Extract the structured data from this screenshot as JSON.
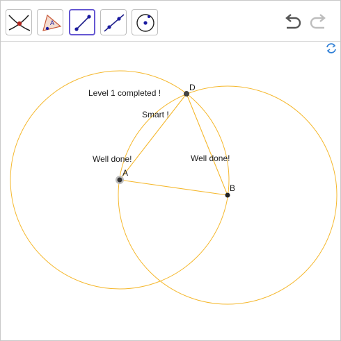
{
  "toolbar": {
    "tools": [
      {
        "name": "move-tool",
        "icon": "move-cross-icon"
      },
      {
        "name": "polygon-tool",
        "icon": "polygon-icon",
        "badge": "A"
      },
      {
        "name": "segment-tool",
        "icon": "segment-icon",
        "selected": true
      },
      {
        "name": "line-tool",
        "icon": "line-icon"
      },
      {
        "name": "circle-tool",
        "icon": "circle-point-icon"
      }
    ],
    "undo_icon": "undo-icon",
    "redo_icon": "redo-icon"
  },
  "graphics": {
    "refresh_icon": "refresh-view-icon",
    "circle_color": "#f5b82e",
    "messages": {
      "level": "Level 1 completed !",
      "smart": "Smart !",
      "well_done_1": "Well done!",
      "well_done_2": "Well done!"
    },
    "points": {
      "A": "A",
      "B": "B",
      "D": "D"
    }
  }
}
